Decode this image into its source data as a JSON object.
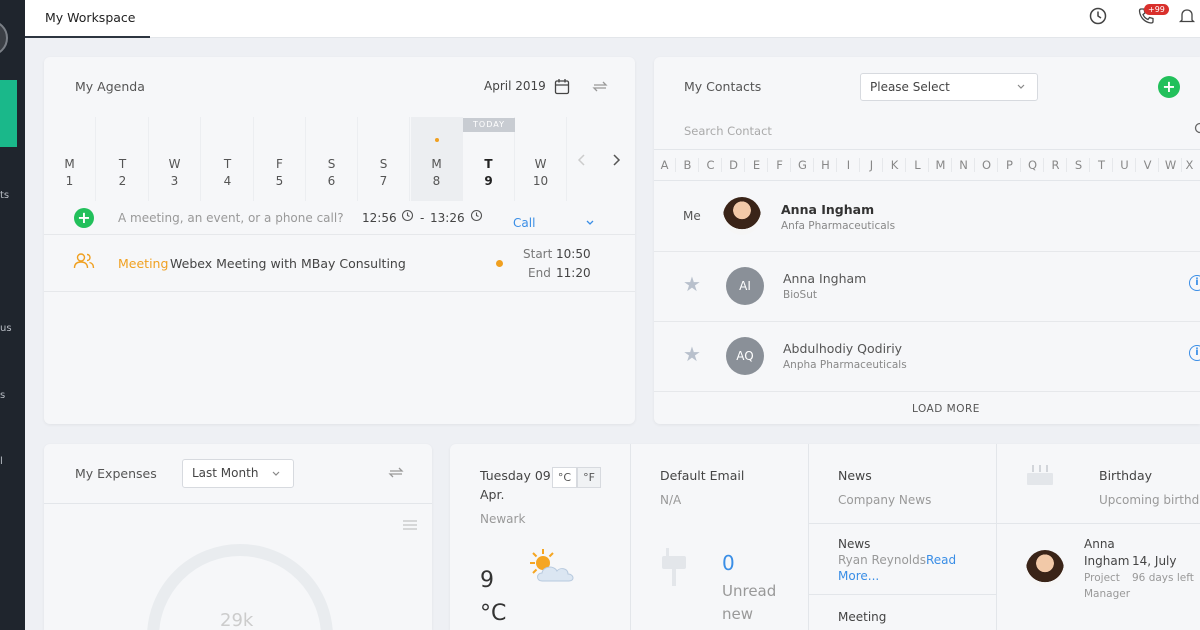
{
  "app": {
    "workspace_tab": "My Workspace",
    "notification_badge": "+99",
    "sidebar_fragments": [
      "ts",
      "us",
      "s",
      "l"
    ]
  },
  "agenda": {
    "title": "My Agenda",
    "month": "April 2019",
    "today_label": "TODAY",
    "days": [
      {
        "name": "M",
        "date": "1"
      },
      {
        "name": "T",
        "date": "2"
      },
      {
        "name": "W",
        "date": "3"
      },
      {
        "name": "T",
        "date": "4"
      },
      {
        "name": "F",
        "date": "5"
      },
      {
        "name": "S",
        "date": "6"
      },
      {
        "name": "S",
        "date": "7"
      },
      {
        "name": "M",
        "date": "8"
      },
      {
        "name": "T",
        "date": "9"
      },
      {
        "name": "W",
        "date": "10"
      }
    ],
    "new_event_placeholder": "A meeting, an event, or a phone call?",
    "start_time": "12:56",
    "dash": "-",
    "end_time": "13:26",
    "event_type": "Call",
    "event": {
      "category": "Meeting",
      "title": "Webex Meeting with MBay Consulting",
      "start_label": "Start",
      "start": "10:50",
      "end_label": "End",
      "end": "11:20"
    }
  },
  "contacts": {
    "title": "My Contacts",
    "select_value": "Please Select",
    "search_placeholder": "Search Contact",
    "letters": [
      "A",
      "B",
      "C",
      "D",
      "E",
      "F",
      "G",
      "H",
      "I",
      "J",
      "K",
      "L",
      "M",
      "N",
      "O",
      "P",
      "Q",
      "R",
      "S",
      "T",
      "U",
      "V",
      "W",
      "X"
    ],
    "me_label": "Me",
    "me": {
      "name": "Anna Ingham",
      "company": "Anfa Pharmaceuticals"
    },
    "list": [
      {
        "initials": "AI",
        "name": "Anna Ingham",
        "company": "BioSut"
      },
      {
        "initials": "AQ",
        "name": "Abdulhodiy Qodiriy",
        "company": "Anpha Pharmaceuticals"
      }
    ],
    "load_more": "LOAD MORE"
  },
  "expenses": {
    "title": "My Expenses",
    "period": "Last Month",
    "total": "29k"
  },
  "weather": {
    "date_line1": "Tuesday 09",
    "date_line2": "Apr.",
    "city": "Newark",
    "temp": "9",
    "unit": "°C",
    "unit_c": "°C",
    "unit_f": "°F"
  },
  "email": {
    "title": "Default Email",
    "value": "N/A",
    "count": "0",
    "count_label1": "Unread",
    "count_label2": "new"
  },
  "news": {
    "title": "News",
    "subtitle": "Company News",
    "item_label": "News",
    "item_text": "Ryan Reynolds",
    "read_more1": "Read",
    "read_more2": "More...",
    "meeting_label": "Meeting"
  },
  "birthday": {
    "title": "Birthday",
    "subtitle": "Upcoming birthd",
    "person_first": "Anna",
    "person_last": "Ingham",
    "date": "14, July",
    "role1": "Project",
    "role2": "Manager",
    "days_left": "96 days left"
  },
  "colors": {
    "accent_green": "#22c05b",
    "orange": "#f0a020",
    "link_blue": "#3a8ee6"
  }
}
